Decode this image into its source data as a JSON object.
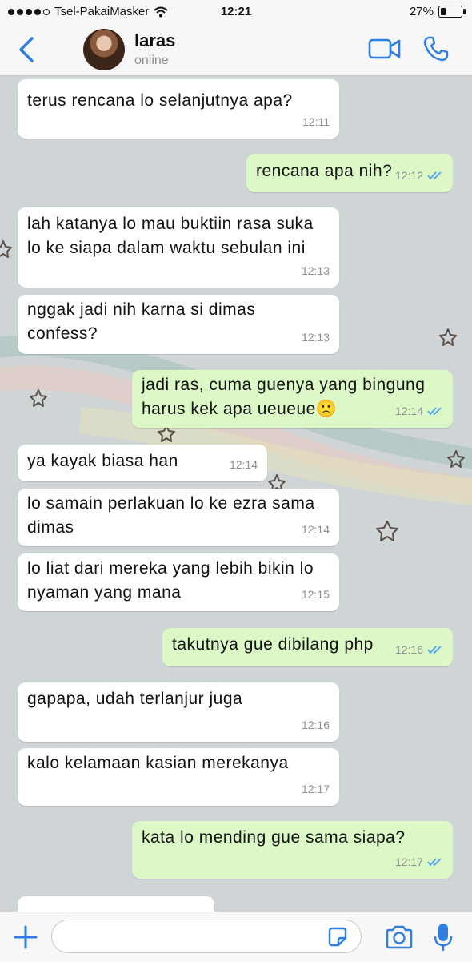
{
  "status": {
    "carrier": "Tsel-PakaiMasker",
    "time": "12:21",
    "battery": "27%",
    "battery_level": 0.27
  },
  "header": {
    "name": "laras",
    "presence": "online"
  },
  "messages": [
    {
      "dir": "in",
      "text": "terus rencana lo selanjutnya apa?",
      "time": "12:11"
    },
    {
      "dir": "out",
      "text": "rencana apa nih?",
      "time": "12:12"
    },
    {
      "dir": "in",
      "text": "lah katanya lo mau buktiin rasa suka lo ke siapa dalam waktu sebulan ini",
      "time": "12:13"
    },
    {
      "dir": "in",
      "text": "nggak jadi nih karna si dimas confess?",
      "time": "12:13"
    },
    {
      "dir": "out",
      "text": "jadi ras, cuma guenya yang bingung harus kek apa ueueue🙁",
      "time": "12:14"
    },
    {
      "dir": "in",
      "text": "ya kayak biasa han",
      "time": "12:14"
    },
    {
      "dir": "in",
      "text": "lo samain perlakuan lo ke ezra sama dimas",
      "time": "12:14"
    },
    {
      "dir": "in",
      "text": "lo liat dari mereka yang lebih bikin lo nyaman yang mana",
      "time": "12:15"
    },
    {
      "dir": "out",
      "text": "takutnya gue dibilang php",
      "time": "12:16"
    },
    {
      "dir": "in",
      "text": "gapapa, udah terlanjur juga",
      "time": "12:16"
    },
    {
      "dir": "in",
      "text": "kalo kelamaan kasian merekanya",
      "time": "12:17"
    },
    {
      "dir": "out",
      "text": "kata lo mending gue sama siapa?",
      "time": "12:17"
    }
  ],
  "input": {
    "value": ""
  },
  "colors": {
    "accent": "#2f7fe0",
    "outgoing_bubble": "#dcf8c6",
    "incoming_bubble": "#ffffff",
    "read_ticks": "#4fa3f7"
  }
}
